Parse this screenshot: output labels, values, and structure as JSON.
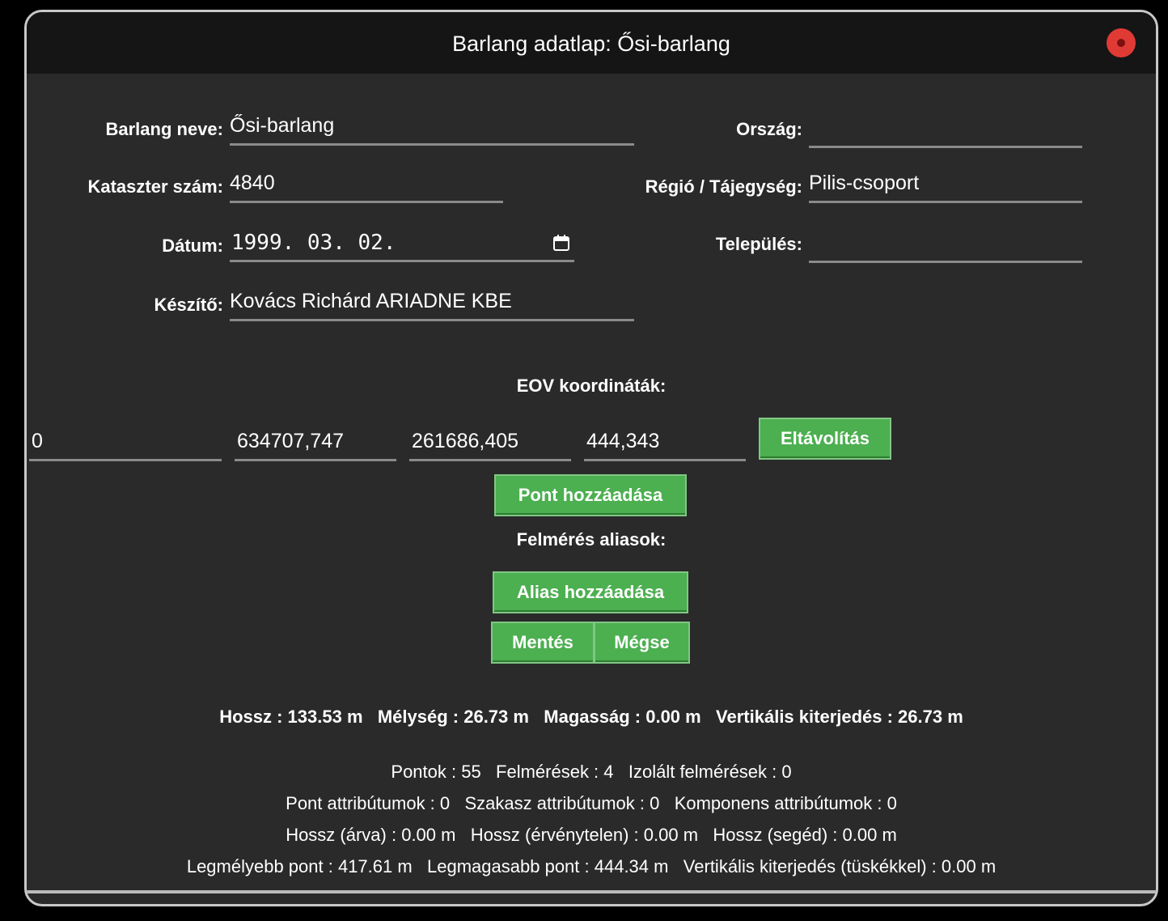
{
  "window": {
    "title": "Barlang adatlap: Ősi-barlang"
  },
  "form": {
    "name_label": "Barlang neve:",
    "name_value": "Ősi-barlang",
    "country_label": "Ország:",
    "country_value": "",
    "cadastre_label": "Kataszter szám:",
    "cadastre_value": "4840",
    "region_label": "Régió / Tájegység:",
    "region_value": "Pilis-csoport",
    "date_label": "Dátum:",
    "date_value": "1999. 03. 02.",
    "settlement_label": "Település:",
    "settlement_value": "",
    "author_label": "Készítő:",
    "author_value": "Kovács Richárd ARIADNE KBE"
  },
  "eov": {
    "title": "EOV koordináták:",
    "point_name": "0",
    "x": "634707,747",
    "y": "261686,405",
    "z": "444,343",
    "remove_label": "Eltávolítás",
    "add_point_label": "Pont hozzáadása"
  },
  "aliases": {
    "title": "Felmérés aliasok:",
    "add_alias_label": "Alias hozzáadása"
  },
  "actions": {
    "save_label": "Mentés",
    "cancel_label": "Mégse"
  },
  "stats": {
    "summary": "Hossz : 133.53 m   Mélység : 26.73 m   Magasság : 0.00 m   Vertikális kiterjedés : 26.73 m",
    "line1": "Pontok : 55   Felmérések : 4   Izolált felmérések : 0",
    "line2": "Pont attribútumok : 0   Szakasz attribútumok : 0   Komponens attribútumok : 0",
    "line3": "Hossz (árva) : 0.00 m   Hossz (érvénytelen) : 0.00 m   Hossz (segéd) : 0.00 m",
    "line4": "Legmélyebb pont : 417.61 m   Legmagasabb pont : 444.34 m   Vertikális kiterjedés (tüskékkel) : 0.00 m"
  },
  "icons": {
    "close": "close-icon",
    "calendar": "calendar-icon"
  },
  "colors": {
    "button": "#4caf50",
    "close": "#e03a35",
    "background": "#2a2a2a",
    "titlebar": "#151515"
  }
}
